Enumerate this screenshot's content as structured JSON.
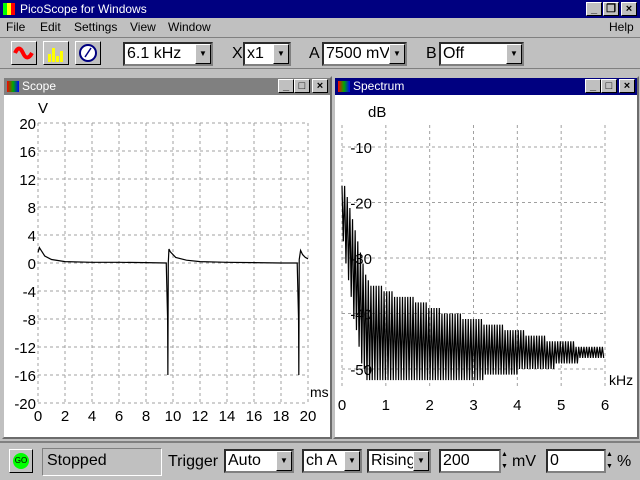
{
  "app": {
    "title": "PicoScope for Windows"
  },
  "menu": {
    "file": "File",
    "edit": "Edit",
    "settings": "Settings",
    "view": "View",
    "window": "Window",
    "help": "Help"
  },
  "toolbar": {
    "timebase": "6.1 kHz",
    "x_label": "X",
    "x_zoom": "x1",
    "a_label": "A",
    "a_range": "7500 mV",
    "b_label": "B",
    "b_range": "Off"
  },
  "scope": {
    "title": "Scope",
    "active": false
  },
  "spectrum": {
    "title": "Spectrum",
    "active": true
  },
  "status": {
    "go": "GO",
    "state": "Stopped",
    "trigger_label": "Trigger",
    "trigger_mode": "Auto",
    "trigger_channel": "ch A",
    "trigger_edge": "Rising",
    "threshold": "200",
    "threshold_unit": "mV",
    "delay": "0",
    "delay_unit": "%"
  },
  "colors": {
    "titlebar_active": "#000080",
    "titlebar_inactive": "#808080",
    "go": "#00ff00"
  },
  "chart_data": [
    {
      "type": "line",
      "title": "Scope",
      "ylabel": "V",
      "xlabel": "ms",
      "xlim": [
        0,
        20
      ],
      "ylim": [
        -20,
        20
      ],
      "xticks": [
        "0",
        "2",
        "4",
        "6",
        "8",
        "10",
        "12",
        "14",
        "16",
        "18",
        "20"
      ],
      "yticks": [
        "20",
        "16",
        "12",
        "8",
        "4",
        "0",
        "-4",
        "-8",
        "-12",
        "-16",
        "-20"
      ],
      "x": [
        0,
        0.1,
        0.5,
        1,
        2,
        4,
        6,
        8,
        9.5,
        9.6,
        9.62,
        9.65,
        9.7,
        9.8,
        10.2,
        11,
        12,
        14,
        16,
        18,
        19.2,
        19.3,
        19.32,
        19.35,
        19.45,
        19.6,
        19.8,
        20
      ],
      "y": [
        1.5,
        2.2,
        1.0,
        0.5,
        0.2,
        0.1,
        0.1,
        0.05,
        0.0,
        -8,
        -16,
        0,
        2.0,
        1.6,
        0.8,
        0.4,
        0.2,
        0.1,
        0.05,
        0.0,
        0.0,
        -8,
        -16,
        0.5,
        1.8,
        1.2,
        0.8,
        0.6
      ]
    },
    {
      "type": "line",
      "title": "Spectrum",
      "ylabel": "dB",
      "xlabel": "kHz",
      "xlim": [
        0,
        6
      ],
      "ylim": [
        -52,
        0
      ],
      "xticks": [
        "0",
        "1",
        "2",
        "3",
        "4",
        "5",
        "6"
      ],
      "yticks": [
        "-10",
        "-20",
        "-30",
        "-40",
        "-50"
      ],
      "peak_spacing_khz": 0.06,
      "peaks": [
        -17,
        -17,
        -19,
        -21,
        -23,
        -25,
        -27,
        -29,
        -31,
        -33,
        -34,
        -35,
        -35,
        -35,
        -35,
        -35,
        -36,
        -36,
        -36,
        -36,
        -37,
        -37,
        -37,
        -37,
        -37,
        -37,
        -37,
        -37,
        -38,
        -38,
        -38,
        -38,
        -38,
        -39,
        -39,
        -39,
        -39,
        -39,
        -40,
        -40,
        -40,
        -40,
        -40,
        -40,
        -40,
        -40,
        -41,
        -41,
        -41,
        -41,
        -41,
        -41,
        -41,
        -41,
        -42,
        -42,
        -42,
        -42,
        -42,
        -42,
        -42,
        -42,
        -43,
        -43,
        -43,
        -43,
        -43,
        -43,
        -43,
        -43,
        -44,
        -44,
        -44,
        -44,
        -44,
        -44,
        -44,
        -44,
        -45,
        -45,
        -45,
        -45,
        -45,
        -45,
        -45,
        -45,
        -45,
        -45,
        -45,
        -46,
        -46,
        -46,
        -46,
        -46,
        -46,
        -46,
        -46,
        -46,
        -46,
        -46
      ],
      "troughs": [
        -27,
        -31,
        -34,
        -37,
        -41,
        -43,
        -46,
        -49,
        -50,
        -52,
        -52,
        -52,
        -52,
        -52,
        -52,
        -52,
        -52,
        -52,
        -52,
        -52,
        -52,
        -52,
        -52,
        -52,
        -52,
        -52,
        -52,
        -52,
        -52,
        -52,
        -52,
        -52,
        -52,
        -52,
        -52,
        -52,
        -52,
        -52,
        -52,
        -52,
        -52,
        -52,
        -52,
        -52,
        -52,
        -52,
        -52,
        -52,
        -52,
        -52,
        -52,
        -52,
        -52,
        -52,
        -51,
        -51,
        -51,
        -51,
        -51,
        -51,
        -51,
        -51,
        -51,
        -51,
        -51,
        -51,
        -51,
        -50,
        -50,
        -50,
        -50,
        -50,
        -50,
        -50,
        -50,
        -50,
        -50,
        -50,
        -50,
        -50,
        -50,
        -49,
        -49,
        -49,
        -49,
        -49,
        -49,
        -49,
        -49,
        -49,
        -48,
        -48,
        -48,
        -48,
        -48,
        -48,
        -48,
        -48,
        -48,
        -48,
        -48
      ]
    }
  ]
}
